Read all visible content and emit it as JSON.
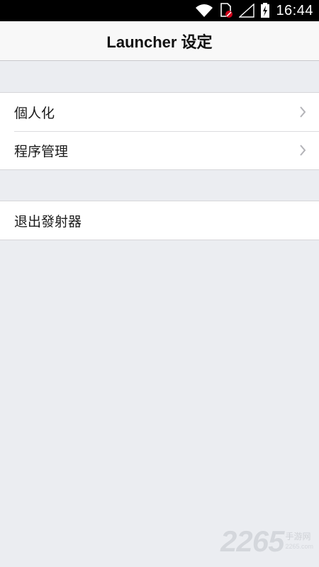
{
  "status_bar": {
    "time": "16:44",
    "icons": [
      "wifi-icon",
      "sim-card-blocked-icon",
      "cell-signal-icon",
      "battery-charging-icon"
    ]
  },
  "header": {
    "title": "Launcher 设定"
  },
  "menu": {
    "group1": [
      {
        "label": "個人化",
        "icon": "chevron-right-icon"
      },
      {
        "label": "程序管理",
        "icon": "chevron-right-icon"
      }
    ],
    "group2": [
      {
        "label": "退出發射器"
      }
    ]
  },
  "watermark": {
    "number": "2265",
    "text": "手游网",
    "url": "2265.com"
  },
  "colors": {
    "background": "#ebedf1",
    "header_bg": "#f8f8f8",
    "row_bg": "#ffffff",
    "chevron": "#b3b3b8"
  }
}
